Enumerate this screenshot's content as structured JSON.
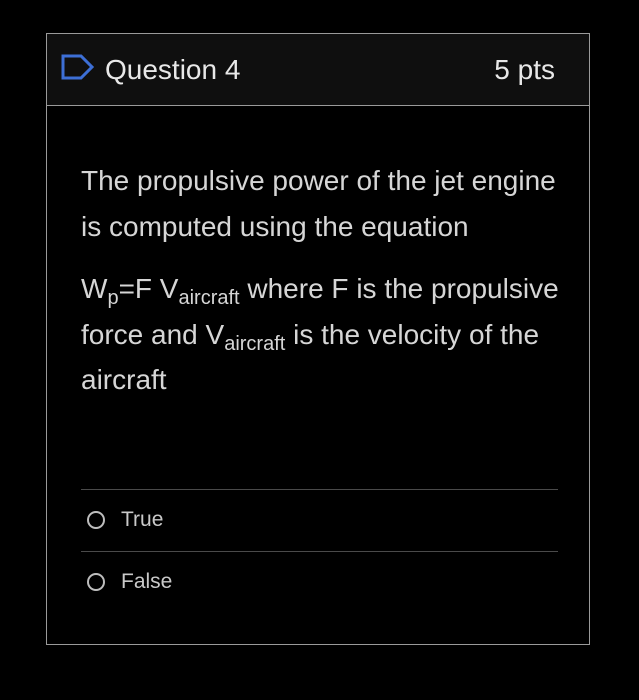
{
  "question": {
    "title": "Question 4",
    "points": "5 pts",
    "flag_icon": "flag-outline-icon",
    "paragraph1": "The propulsive power of the jet engine is computed using the equation",
    "paragraph2": {
      "w": "W",
      "w_sub": "p",
      "eq": "=F V",
      "v_sub1": "aircraft",
      "mid": " where F is the propulsive force and  V",
      "v_sub2": "aircraft",
      "end": " is the velocity of the aircraft"
    }
  },
  "answers": [
    {
      "label": "True",
      "selected": false
    },
    {
      "label": "False",
      "selected": false
    }
  ],
  "colors": {
    "background": "#000000",
    "header_background": "#0f0f0f",
    "border": "#9a9a9a",
    "text": "#d6d6d6",
    "flag_accent": "#3d6fd6"
  }
}
